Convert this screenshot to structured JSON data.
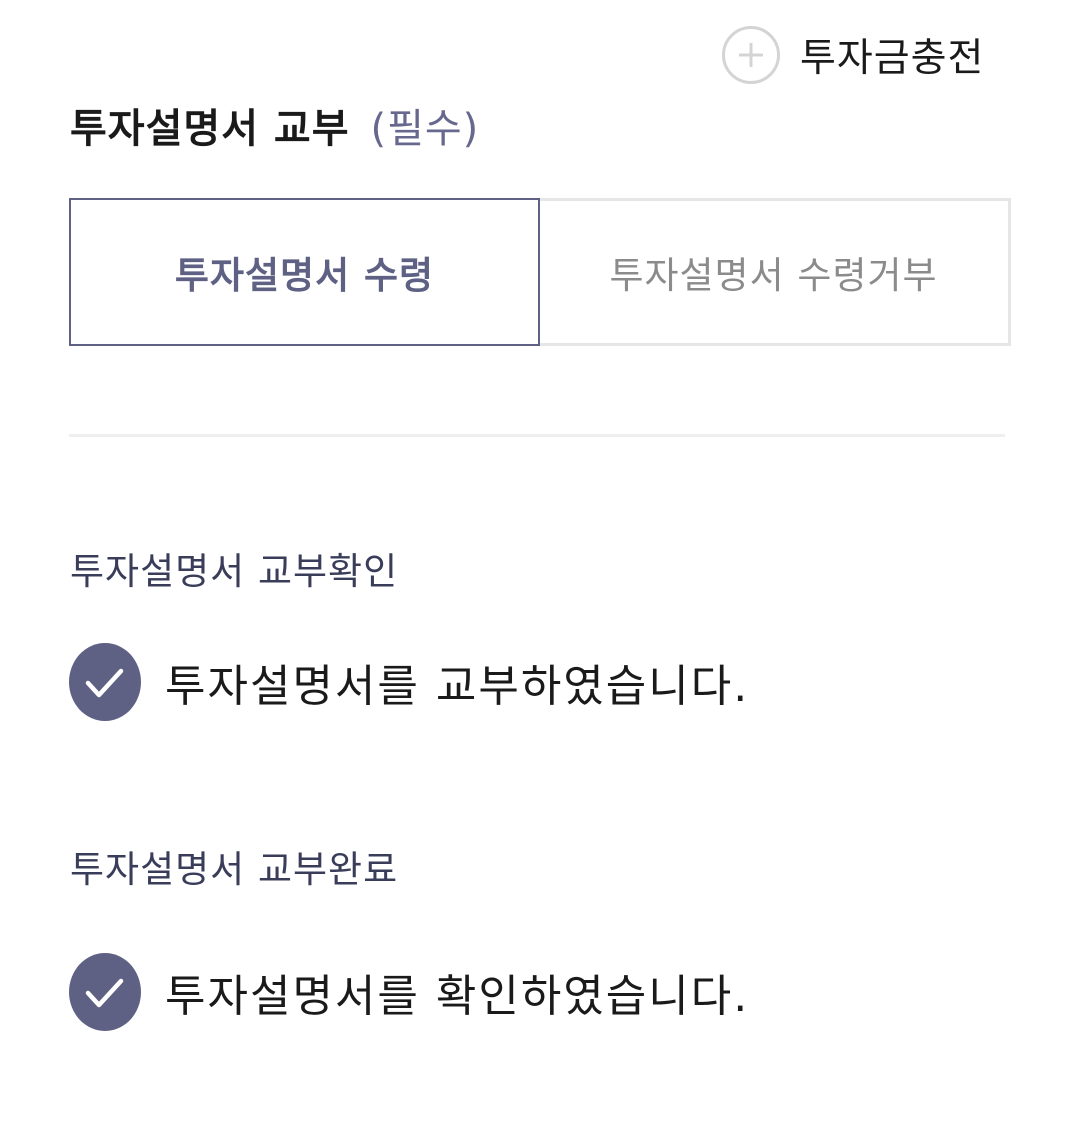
{
  "top_action": {
    "icon": "plus-circle-icon",
    "label": "투자금충전"
  },
  "section": {
    "title": "투자설명서 교부",
    "required": "(필수)"
  },
  "toggle": {
    "selected": "투자설명서 수령",
    "unselected": "투자설명서 수령거부"
  },
  "confirm_group": {
    "label": "투자설명서 교부확인",
    "check_text": "투자설명서를 교부하였습니다.",
    "checked": true
  },
  "complete_group": {
    "label": "투자설명서 교부완료",
    "check_text": "투자설명서를 확인하였습니다.",
    "checked": true
  },
  "colors": {
    "accent": "#5e6184",
    "required_text": "#66688d",
    "unselected_text": "#8b8b8b",
    "border_light": "#e6e6e6"
  }
}
